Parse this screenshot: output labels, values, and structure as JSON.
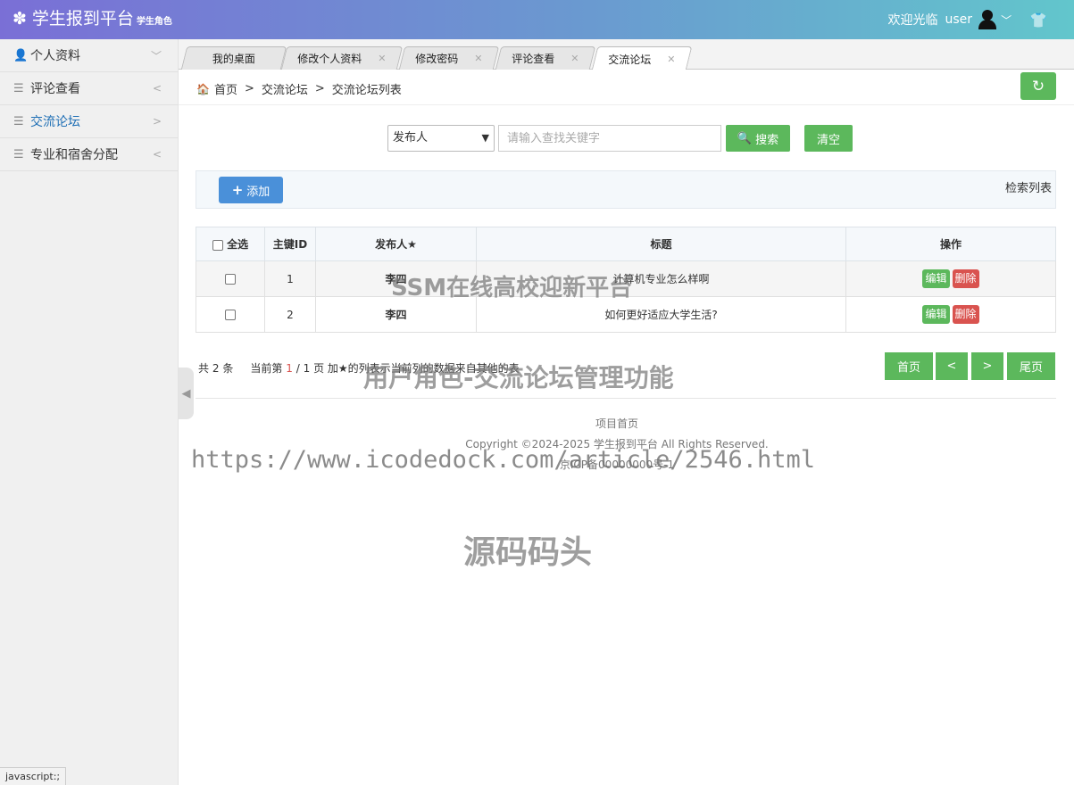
{
  "header": {
    "logo_icon": "flower-gear-icon",
    "title": "学生报到平台",
    "role": "学生角色",
    "welcome": "欢迎光临",
    "username": "user",
    "gradient": [
      "#7a6fd6",
      "#62c6cc"
    ]
  },
  "sidebar": {
    "items": [
      {
        "label": "个人资料",
        "icon": "user-icon",
        "arrow": "﹀"
      },
      {
        "label": "评论查看",
        "icon": "menu-icon",
        "arrow": "<"
      },
      {
        "label": "交流论坛",
        "icon": "menu-icon",
        "arrow": ">"
      },
      {
        "label": "专业和宿舍分配",
        "icon": "menu-icon",
        "arrow": "<"
      }
    ],
    "active_color": "#1f6fb5",
    "status_text": "javascript:;"
  },
  "tabs": [
    {
      "label": "我的桌面"
    },
    {
      "label": "修改个人资料"
    },
    {
      "label": "修改密码"
    },
    {
      "label": "评论查看"
    },
    {
      "label": "交流论坛"
    }
  ],
  "breadcrumb": {
    "home": "首页",
    "sep": ">",
    "level1": "交流论坛",
    "level2": "交流论坛列表"
  },
  "search": {
    "field_selected": "发布人",
    "placeholder": "请输入查找关键字",
    "search_label": "搜索",
    "clear_label": "清空"
  },
  "toolbar": {
    "add_label": "添加",
    "list_title": "检索列表"
  },
  "table": {
    "headers": {
      "select_all": "全选",
      "id": "主键ID",
      "author": "发布人★",
      "title": "标题",
      "actions": "操作"
    },
    "rows": [
      {
        "id": "1",
        "author": "李四",
        "title": "计算机专业怎么样啊",
        "edit": "编辑",
        "delete": "删除"
      },
      {
        "id": "2",
        "author": "李四",
        "title": "如何更好适应大学生活?",
        "edit": "编辑",
        "delete": "删除"
      }
    ]
  },
  "pager": {
    "total_prefix": "共",
    "total": "2",
    "total_suffix": "条",
    "current_prefix": "当前第",
    "current": "1",
    "page_sep": "/",
    "pages": "1",
    "page_suffix": "页",
    "note": "加★的列表示当前列的数据来自其他的表",
    "first": "首页",
    "prev": "<",
    "next": ">",
    "last": "尾页"
  },
  "footer": {
    "home_link": "项目首页",
    "copyright": "Copyright ©2024-2025 学生报到平台 All Rights Reserved.",
    "icp": "京ICP备00000000号-1"
  },
  "watermarks": {
    "line1": "SSM在线高校迎新平台",
    "line2": "用户角色-交流论坛管理功能",
    "line3": "https://www.icodedock.com/article/2546.html",
    "line4": "源码码头"
  },
  "colors": {
    "green": "#5cb85c",
    "blue": "#4a90d9",
    "red": "#d9534f",
    "author": "#a52a2a"
  }
}
